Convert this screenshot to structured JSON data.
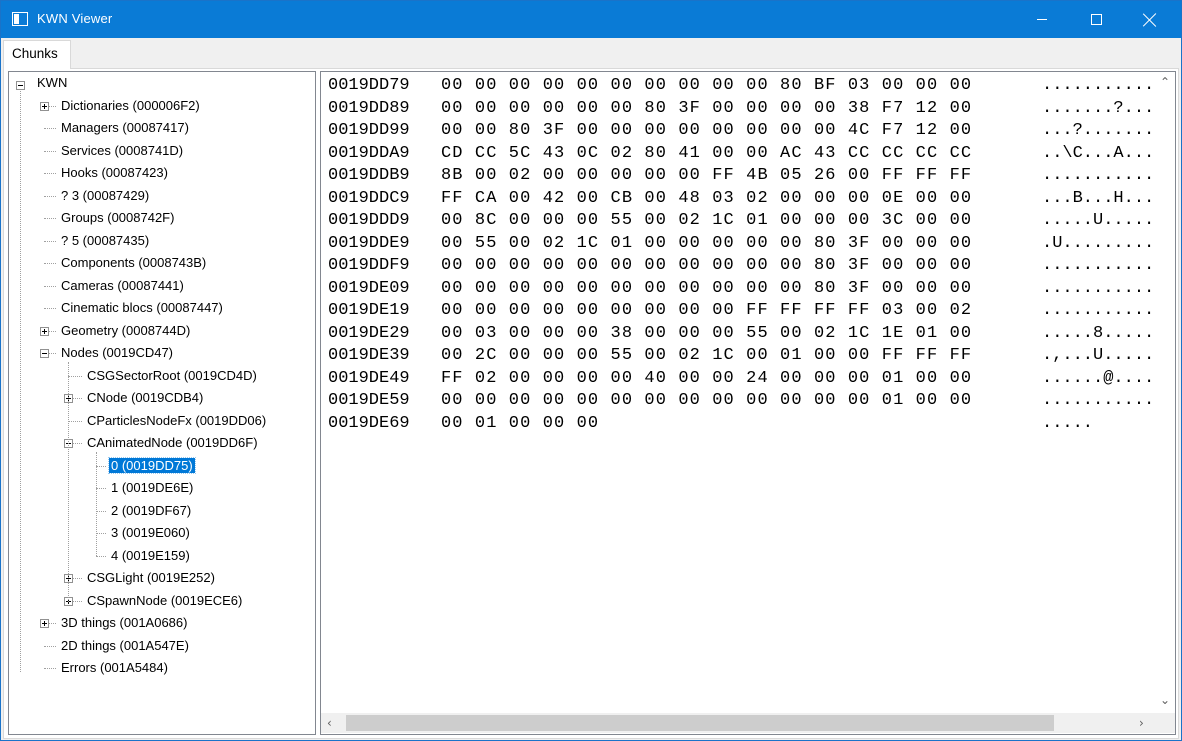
{
  "window": {
    "title": "KWN Viewer"
  },
  "window_controls": {
    "minimize": "minimize-icon",
    "maximize": "maximize-icon",
    "close": "close-icon"
  },
  "tabs": [
    {
      "label": "Chunks",
      "active": true
    }
  ],
  "tree": {
    "root": "KWN",
    "items": [
      {
        "label": "Dictionaries (000006F2)",
        "expander": "plus"
      },
      {
        "label": "Managers (00087417)"
      },
      {
        "label": "Services (0008741D)"
      },
      {
        "label": "Hooks (00087423)"
      },
      {
        "label": "? 3 (00087429)"
      },
      {
        "label": "Groups (0008742F)"
      },
      {
        "label": "? 5 (00087435)"
      },
      {
        "label": "Components (0008743B)"
      },
      {
        "label": "Cameras (00087441)"
      },
      {
        "label": "Cinematic blocs (00087447)"
      },
      {
        "label": "Geometry (0008744D)",
        "expander": "plus"
      },
      {
        "label": "Nodes (0019CD47)",
        "expander": "minus"
      },
      {
        "label": "CSGSectorRoot (0019CD4D)"
      },
      {
        "label": "CNode (0019CDB4)",
        "expander": "plus"
      },
      {
        "label": "CParticlesNodeFx (0019DD06)"
      },
      {
        "label": "CAnimatedNode (0019DD6F)",
        "expander": "minus"
      },
      {
        "label": "0 (0019DD75)",
        "selected": true
      },
      {
        "label": "1 (0019DE6E)"
      },
      {
        "label": "2 (0019DF67)"
      },
      {
        "label": "3 (0019E060)"
      },
      {
        "label": "4 (0019E159)"
      },
      {
        "label": "CSGLight (0019E252)",
        "expander": "plus"
      },
      {
        "label": "CSpawnNode (0019ECE6)",
        "expander": "plus"
      },
      {
        "label": "3D things (001A0686)",
        "expander": "plus"
      },
      {
        "label": "2D things (001A547E)"
      },
      {
        "label": "Errors (001A5484)"
      }
    ]
  },
  "hex_rows": [
    {
      "addr": "0019DD79",
      "bytes": "00 00 00 00 00 00 00 00 00 00 80 BF 03 00 00 00",
      "ascii": "..........."
    },
    {
      "addr": "0019DD89",
      "bytes": "00 00 00 00 00 00 80 3F 00 00 00 00 38 F7 12 00",
      "ascii": ".......?..."
    },
    {
      "addr": "0019DD99",
      "bytes": "00 00 80 3F 00 00 00 00 00 00 00 00 4C F7 12 00",
      "ascii": "...?......."
    },
    {
      "addr": "0019DDA9",
      "bytes": "CD CC 5C 43 0C 02 80 41 00 00 AC 43 CC CC CC CC",
      "ascii": "..\\C...A..."
    },
    {
      "addr": "0019DDB9",
      "bytes": "8B 00 02 00 00 00 00 00 FF 4B 05 26 00 FF FF FF",
      "ascii": "..........."
    },
    {
      "addr": "0019DDC9",
      "bytes": "FF CA 00 42 00 CB 00 48 03 02 00 00 00 0E 00 00",
      "ascii": "...B...H..."
    },
    {
      "addr": "0019DDD9",
      "bytes": "00 8C 00 00 00 55 00 02 1C 01 00 00 00 3C 00 00",
      "ascii": ".....U....."
    },
    {
      "addr": "0019DDE9",
      "bytes": "00 55 00 02 1C 01 00 00 00 00 00 80 3F 00 00 00",
      "ascii": ".U........."
    },
    {
      "addr": "0019DDF9",
      "bytes": "00 00 00 00 00 00 00 00 00 00 00 80 3F 00 00 00",
      "ascii": "..........."
    },
    {
      "addr": "0019DE09",
      "bytes": "00 00 00 00 00 00 00 00 00 00 00 80 3F 00 00 00",
      "ascii": "..........."
    },
    {
      "addr": "0019DE19",
      "bytes": "00 00 00 00 00 00 00 00 00 FF FF FF FF 03 00 02",
      "ascii": "..........."
    },
    {
      "addr": "0019DE29",
      "bytes": "00 03 00 00 00 38 00 00 00 55 00 02 1C 1E 01 00",
      "ascii": ".....8....."
    },
    {
      "addr": "0019DE39",
      "bytes": "00 2C 00 00 00 55 00 02 1C 00 01 00 00 FF FF FF",
      "ascii": ".,...U....."
    },
    {
      "addr": "0019DE49",
      "bytes": "FF 02 00 00 00 00 40 00 00 24 00 00 00 01 00 00",
      "ascii": "......@...."
    },
    {
      "addr": "0019DE59",
      "bytes": "00 00 00 00 00 00 00 00 00 00 00 00 00 01 00 00",
      "ascii": "..........."
    },
    {
      "addr": "0019DE69",
      "bytes": "00 01 00 00 00",
      "ascii": "....."
    }
  ],
  "scrollbars": {
    "up": "▲",
    "down": "▼",
    "left": "◀",
    "right": "▶"
  }
}
